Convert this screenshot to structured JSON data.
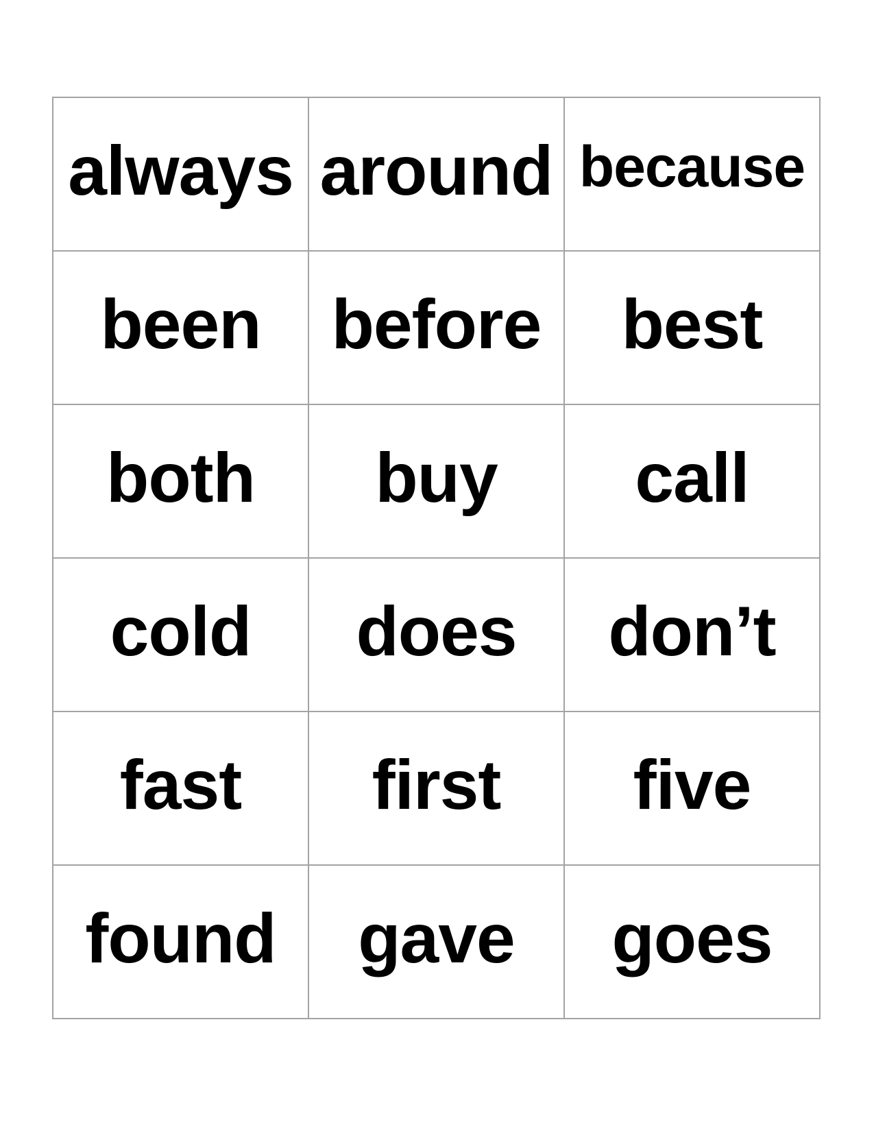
{
  "words": [
    "always",
    "around",
    "because",
    "been",
    "before",
    "best",
    "both",
    "buy",
    "call",
    "cold",
    "does",
    "don’t",
    "fast",
    "first",
    "five",
    "found",
    "gave",
    "goes"
  ]
}
